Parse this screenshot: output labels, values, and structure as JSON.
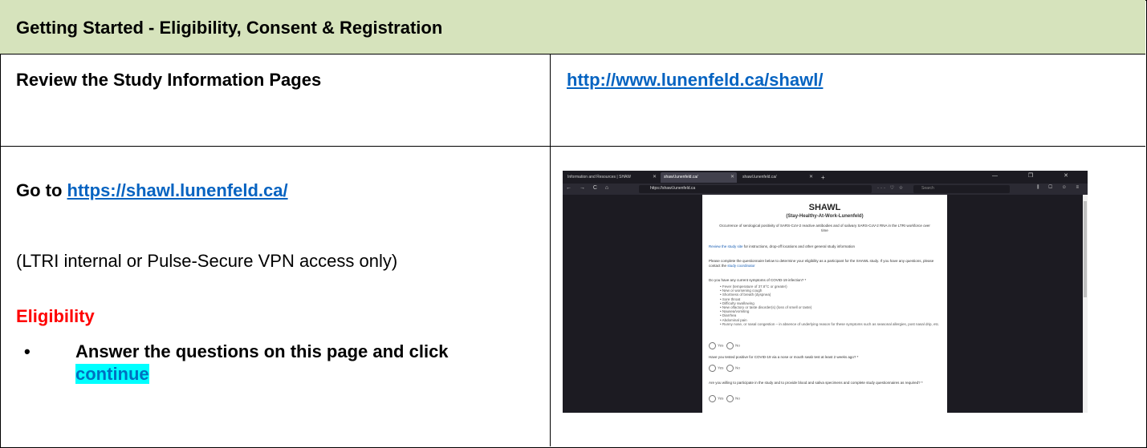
{
  "header": {
    "title": "Getting Started - Eligibility, Consent & Registration"
  },
  "row1": {
    "left": "Review the Study Information Pages",
    "link": "http://www.lunenfeld.ca/shawl/"
  },
  "row2": {
    "goto_prefix": "Go to ",
    "goto_link": "https://shawl.lunenfeld.ca/",
    "access_note": "(LTRI internal or Pulse-Secure VPN access only)",
    "eligibility_heading": "Eligibility",
    "bullet_text": "Answer the questions on this page and click ",
    "bullet_highlight": "continue"
  },
  "screenshot": {
    "tabs": [
      {
        "label": "Information and Resources | SHAW"
      },
      {
        "label": "shawl.lunenfeld.ca/"
      },
      {
        "label": "shawl.lunenfeld.ca/"
      }
    ],
    "new_tab": "+",
    "window_controls": "— ❐ ✕",
    "nav_icons": "← → C ⌂",
    "url": "https://shawl.lunenfeld.ca",
    "url_actions": "··· ♡ ☆",
    "search_placeholder": "Search",
    "right_icons": "⫼ ▢ ☺ ≡",
    "page": {
      "title": "SHAWL",
      "subtitle": "(Stay-Healthy-At-Work-Lunenfeld)",
      "description": "Occurrence of serological positivity of SARS-CoV-2 reactive antibodies and of salivary SARS-CoV-2 RNA in the LTRI workforce over time",
      "review_link": "Review the study site",
      "review_rest": " for instructions, drop-off locations and other general study information",
      "complete_text": "Please complete the questionnaire below to determine your eligibility as a participant for the SHAWL study. If you have any questions, please contact the ",
      "coordinator_link": "study coordinator",
      "q1": "Do you have any current symptoms of COVID-19 infection? *",
      "symptoms": [
        "Fever (temperature of 37.8°C or greater)",
        "New or worsening cough",
        "Shortness of breath (dyspnea)",
        "Sore throat",
        "Difficulty swallowing",
        "New olfactory or taste disorder(s) (loss of smell or taste)",
        "Nausea/vomiting",
        "Diarrhea",
        "Abdominal pain",
        "Runny nose, or nasal congestion – in absence of underlying reason for these symptoms such as seasonal allergies, post nasal drip, etc."
      ],
      "yes": "Yes",
      "no": "No",
      "q2": "Have you tested positive for COVID-19 via a nose or mouth swab test at least 2 weeks ago? *",
      "q3": "Are you willing to participate in the study and to provide blood and saliva specimens and complete study questionnaires as required? *"
    }
  }
}
